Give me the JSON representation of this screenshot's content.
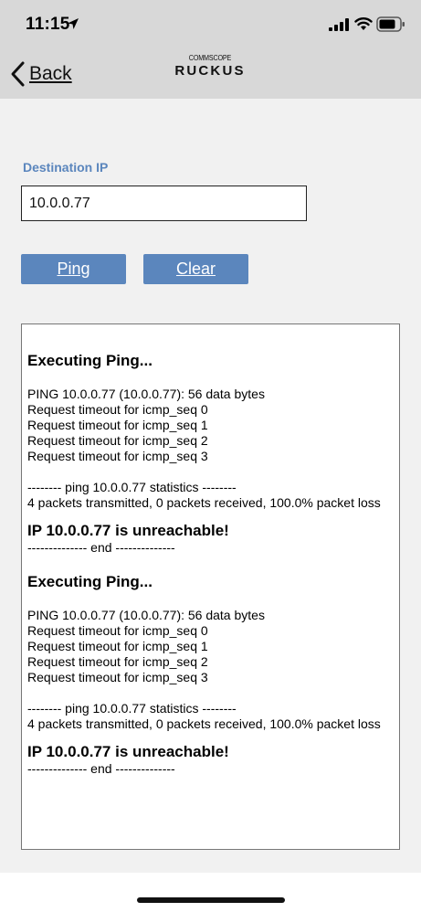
{
  "status_bar": {
    "time": "11:15"
  },
  "nav": {
    "back_label": "Back",
    "logo_top": "COMMSCOPE",
    "logo_main": "RUCKUS"
  },
  "form": {
    "label": "Destination IP",
    "ip_value": "10.0.0.77"
  },
  "buttons": {
    "ping": "Ping",
    "clear": "Clear"
  },
  "output": {
    "blocks": [
      {
        "title": "Executing Ping...",
        "lines": [
          "PING 10.0.0.77 (10.0.0.77): 56 data bytes",
          "Request timeout for icmp_seq 0",
          "Request timeout for icmp_seq 1",
          "Request timeout for icmp_seq 2",
          "Request timeout for icmp_seq 3"
        ],
        "stats_header": "-------- ping 10.0.0.77 statistics --------",
        "stats": "4 packets transmitted, 0 packets received, 100.0% packet loss",
        "result": "IP 10.0.0.77 is unreachable!",
        "end": "-------------- end --------------"
      },
      {
        "title": "Executing Ping...",
        "lines": [
          "PING 10.0.0.77 (10.0.0.77): 56 data bytes",
          "Request timeout for icmp_seq 0",
          "Request timeout for icmp_seq 1",
          "Request timeout for icmp_seq 2",
          "Request timeout for icmp_seq 3"
        ],
        "stats_header": "-------- ping 10.0.0.77 statistics --------",
        "stats": "4 packets transmitted, 0 packets received, 100.0% packet loss",
        "result": "IP 10.0.0.77 is unreachable!",
        "end": "-------------- end --------------"
      }
    ]
  },
  "colors": {
    "accent": "#5b86bd",
    "header_bg": "#d8d8d8",
    "page_bg": "#f1f1f1"
  }
}
